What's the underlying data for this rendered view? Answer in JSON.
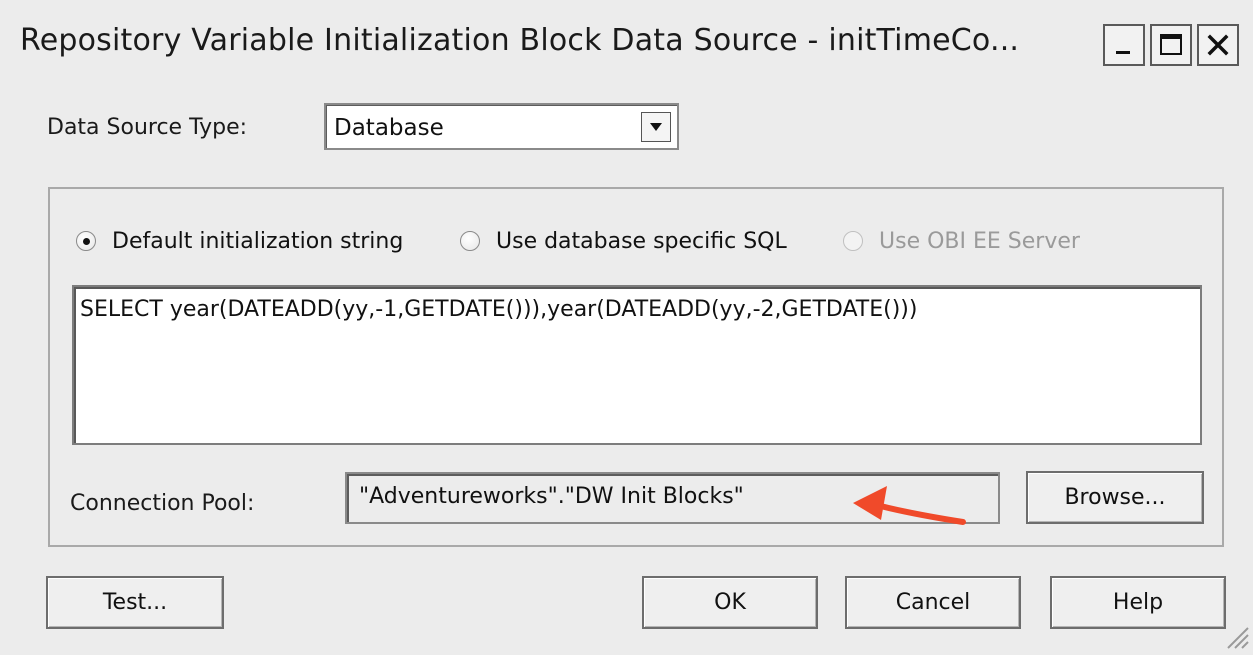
{
  "window": {
    "title": "Repository Variable Initialization Block Data Source - initTimeCo...",
    "controls": [
      "minimize-icon",
      "maximize-icon",
      "close-icon"
    ]
  },
  "data_source_type": {
    "label": "Data Source Type:",
    "value": "Database"
  },
  "options": [
    {
      "label": "Default initialization string",
      "checked": true,
      "enabled": true
    },
    {
      "label": "Use database specific SQL",
      "checked": false,
      "enabled": true
    },
    {
      "label": "Use OBI EE Server",
      "checked": false,
      "enabled": false
    }
  ],
  "sql": "SELECT year(DATEADD(yy,-1,GETDATE())),year(DATEADD(yy,-2,GETDATE()))",
  "connection_pool": {
    "label": "Connection Pool:",
    "value": "\"Adventureworks\".\"DW Init Blocks\"",
    "browse_label": "Browse..."
  },
  "buttons": {
    "test": "Test...",
    "ok": "OK",
    "cancel": "Cancel",
    "help": "Help"
  },
  "colors": {
    "annotation_arrow": "#f04a2a",
    "window_bg": "#ececec"
  }
}
